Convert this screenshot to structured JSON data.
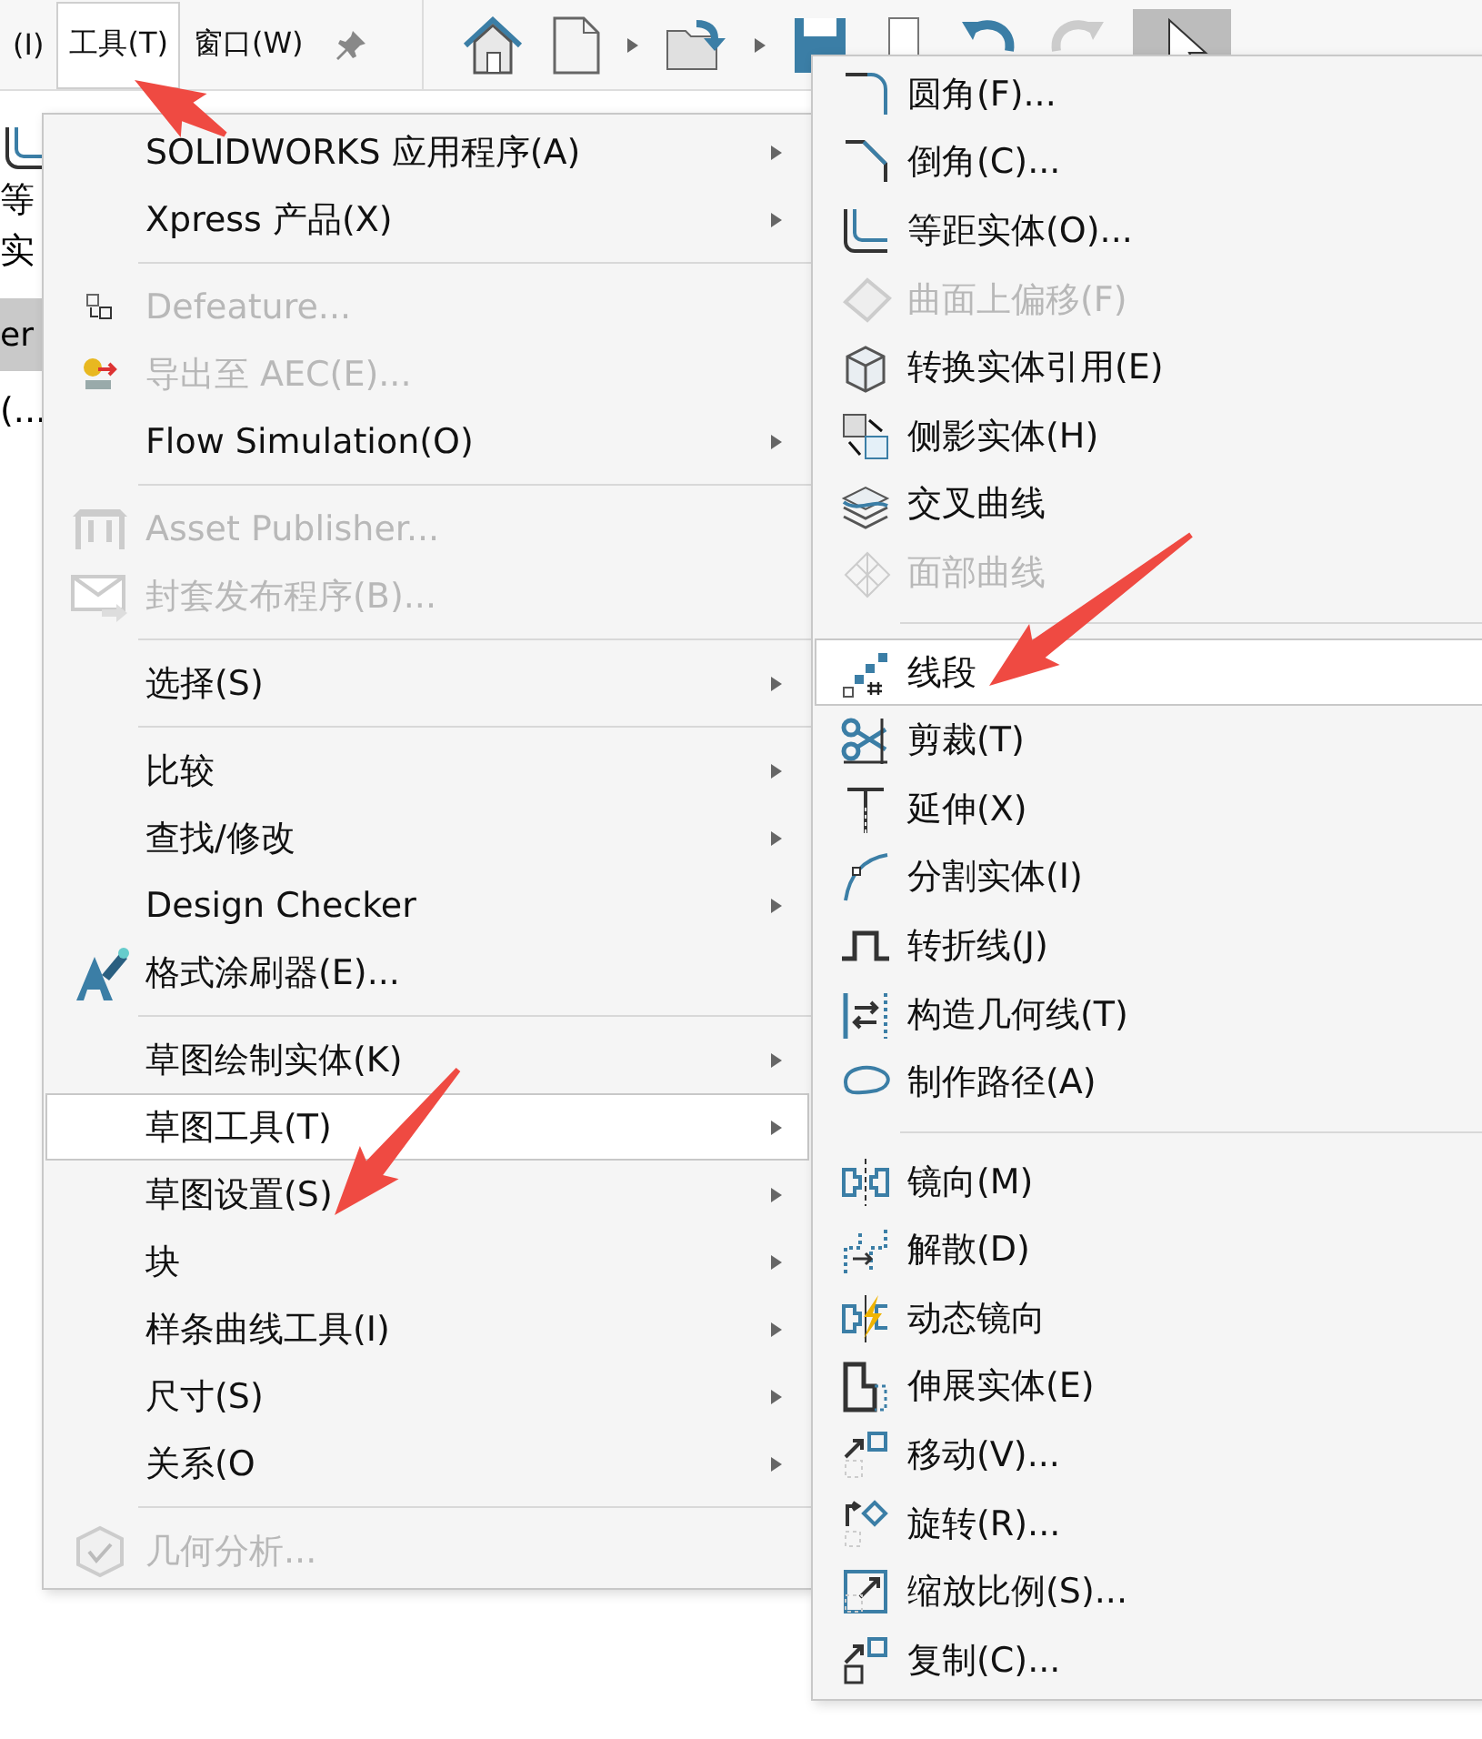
{
  "menu_bar": {
    "items": [
      {
        "label": "(I)",
        "selected": false
      },
      {
        "label": "工具(T)",
        "selected": true
      },
      {
        "label": "窗口(W)",
        "selected": false
      }
    ]
  },
  "side_panel": {
    "texts": [
      "等",
      "实"
    ],
    "tab_label": "er",
    "row_label": "(..."
  },
  "tools_menu": {
    "items": [
      {
        "kind": "item",
        "label": "SOLIDWORKS 应用程序(A)",
        "submenu": true,
        "disabled": false,
        "selected": false
      },
      {
        "kind": "item",
        "label": "Xpress 产品(X)",
        "submenu": true,
        "disabled": false,
        "selected": false
      },
      {
        "kind": "separator"
      },
      {
        "kind": "item",
        "label": "Defeature...",
        "submenu": false,
        "disabled": true,
        "selected": false
      },
      {
        "kind": "item",
        "label": "导出至 AEC(E)...",
        "submenu": false,
        "disabled": true,
        "selected": false
      },
      {
        "kind": "item",
        "label": "Flow Simulation(O)",
        "submenu": true,
        "disabled": false,
        "selected": false
      },
      {
        "kind": "separator"
      },
      {
        "kind": "item",
        "label": "Asset Publisher...",
        "submenu": false,
        "disabled": true,
        "selected": false
      },
      {
        "kind": "item",
        "label": "封套发布程序(B)...",
        "submenu": false,
        "disabled": true,
        "selected": false
      },
      {
        "kind": "separator"
      },
      {
        "kind": "item",
        "label": "选择(S)",
        "submenu": true,
        "disabled": false,
        "selected": false
      },
      {
        "kind": "separator"
      },
      {
        "kind": "item",
        "label": "比较",
        "submenu": true,
        "disabled": false,
        "selected": false
      },
      {
        "kind": "item",
        "label": "查找/修改",
        "submenu": true,
        "disabled": false,
        "selected": false
      },
      {
        "kind": "item",
        "label": "Design Checker",
        "submenu": true,
        "disabled": false,
        "selected": false
      },
      {
        "kind": "item",
        "label": "格式涂刷器(E)...",
        "submenu": false,
        "disabled": false,
        "selected": false
      },
      {
        "kind": "separator"
      },
      {
        "kind": "item",
        "label": "草图绘制实体(K)",
        "submenu": true,
        "disabled": false,
        "selected": false
      },
      {
        "kind": "item",
        "label": "草图工具(T)",
        "submenu": true,
        "disabled": false,
        "selected": true
      },
      {
        "kind": "item",
        "label": "草图设置(S)",
        "submenu": true,
        "disabled": false,
        "selected": false
      },
      {
        "kind": "item",
        "label": "块",
        "submenu": true,
        "disabled": false,
        "selected": false
      },
      {
        "kind": "item",
        "label": "样条曲线工具(I)",
        "submenu": true,
        "disabled": false,
        "selected": false
      },
      {
        "kind": "item",
        "label": "尺寸(S)",
        "submenu": true,
        "disabled": false,
        "selected": false
      },
      {
        "kind": "item",
        "label": "关系(O",
        "submenu": true,
        "disabled": false,
        "selected": false
      },
      {
        "kind": "separator"
      },
      {
        "kind": "item",
        "label": "几何分析...",
        "submenu": false,
        "disabled": true,
        "selected": false
      }
    ]
  },
  "sketch_tools_menu": {
    "items": [
      {
        "kind": "item",
        "label": "圆角(F)...",
        "disabled": false,
        "selected": false
      },
      {
        "kind": "item",
        "label": "倒角(C)...",
        "disabled": false,
        "selected": false
      },
      {
        "kind": "item",
        "label": "等距实体(O)...",
        "disabled": false,
        "selected": false
      },
      {
        "kind": "item",
        "label": "曲面上偏移(F)",
        "disabled": true,
        "selected": false
      },
      {
        "kind": "item",
        "label": "转换实体引用(E)",
        "disabled": false,
        "selected": false
      },
      {
        "kind": "item",
        "label": "侧影实体(H)",
        "disabled": false,
        "selected": false
      },
      {
        "kind": "item",
        "label": "交叉曲线",
        "disabled": false,
        "selected": false
      },
      {
        "kind": "item",
        "label": "面部曲线",
        "disabled": true,
        "selected": false
      },
      {
        "kind": "separator"
      },
      {
        "kind": "item",
        "label": "线段",
        "disabled": false,
        "selected": true
      },
      {
        "kind": "item",
        "label": "剪裁(T)",
        "disabled": false,
        "selected": false
      },
      {
        "kind": "item",
        "label": "延伸(X)",
        "disabled": false,
        "selected": false
      },
      {
        "kind": "item",
        "label": "分割实体(I)",
        "disabled": false,
        "selected": false
      },
      {
        "kind": "item",
        "label": "转折线(J)",
        "disabled": false,
        "selected": false
      },
      {
        "kind": "item",
        "label": "构造几何线(T)",
        "disabled": false,
        "selected": false
      },
      {
        "kind": "item",
        "label": "制作路径(A)",
        "disabled": false,
        "selected": false
      },
      {
        "kind": "separator"
      },
      {
        "kind": "item",
        "label": "镜向(M)",
        "disabled": false,
        "selected": false
      },
      {
        "kind": "item",
        "label": "解散(D)",
        "disabled": false,
        "selected": false
      },
      {
        "kind": "item",
        "label": "动态镜向",
        "disabled": false,
        "selected": false
      },
      {
        "kind": "item",
        "label": "伸展实体(E)",
        "disabled": false,
        "selected": false
      },
      {
        "kind": "item",
        "label": "移动(V)...",
        "disabled": false,
        "selected": false
      },
      {
        "kind": "item",
        "label": "旋转(R)...",
        "disabled": false,
        "selected": false
      },
      {
        "kind": "item",
        "label": "缩放比例(S)...",
        "disabled": false,
        "selected": false
      },
      {
        "kind": "item",
        "label": "复制(C)...",
        "disabled": false,
        "selected": false
      }
    ]
  }
}
